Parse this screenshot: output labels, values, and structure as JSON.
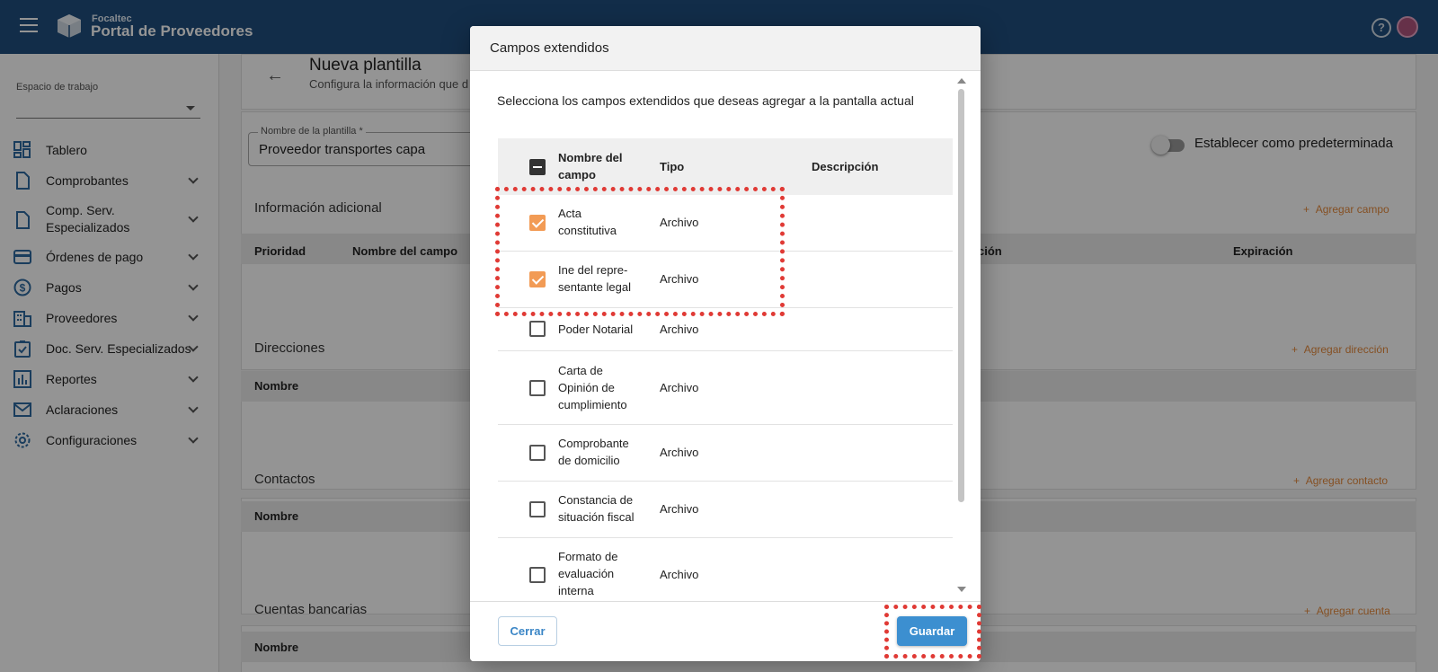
{
  "app": {
    "brand_small": "Focaltec",
    "brand_big": "Portal de Proveedores"
  },
  "sidebar": {
    "workspace_label": "Espacio de trabajo",
    "workspace_value": "",
    "items": [
      {
        "label": "Tablero",
        "icon": "dashboard-icon"
      },
      {
        "label": "Comprobantes",
        "icon": "document-icon"
      },
      {
        "label": "Comp. Serv. Especializados",
        "icon": "document-icon"
      },
      {
        "label": "Órdenes de pago",
        "icon": "credit-card-icon"
      },
      {
        "label": "Pagos",
        "icon": "dollar-icon"
      },
      {
        "label": "Proveedores",
        "icon": "building-icon"
      },
      {
        "label": "Doc. Serv. Especializados",
        "icon": "clipboard-check-icon"
      },
      {
        "label": "Reportes",
        "icon": "bar-chart-icon"
      },
      {
        "label": "Aclaraciones",
        "icon": "mail-icon"
      },
      {
        "label": "Configuraciones",
        "icon": "gear-icon"
      }
    ]
  },
  "page": {
    "title": "Nueva plantilla",
    "subtitle": "Configura la información que d",
    "template_name_label": "Nombre de la plantilla *",
    "template_name_value": "Proveedor transportes capa",
    "default_toggle_label": "Establecer como predeterminada",
    "default_toggle_on": false,
    "sections": [
      {
        "title": "Información adicional",
        "action": "Agregar campo",
        "headers": [
          "Prioridad",
          "Nombre del campo",
          "ción",
          "Expiración"
        ]
      },
      {
        "title": "Direcciones",
        "action": "Agregar dirección",
        "headers": [
          "Nombre"
        ]
      },
      {
        "title": "Contactos",
        "action": "Agregar contacto",
        "headers": [
          "Nombre"
        ]
      },
      {
        "title": "Cuentas bancarias",
        "action": "Agregar cuenta",
        "headers": [
          "Nombre"
        ]
      }
    ]
  },
  "modal": {
    "title": "Campos extendidos",
    "description": "Selecciona los campos extendidos que deseas agregar a la pantalla actual",
    "columns": {
      "name": "Nombre del campo",
      "type": "Tipo",
      "description": "Descripción"
    },
    "rows": [
      {
        "name": "Acta constitutiva",
        "type": "Archivo",
        "checked": true
      },
      {
        "name": "Ine del repre-sentante legal",
        "type": "Archivo",
        "checked": true
      },
      {
        "name": "Poder Notarial",
        "type": "Archivo",
        "checked": false
      },
      {
        "name": "Carta de Opinión de cumplimiento",
        "type": "Archivo",
        "checked": false
      },
      {
        "name": "Comprobante de domicilio",
        "type": "Archivo",
        "checked": false
      },
      {
        "name": "Constancia de situación fiscal",
        "type": "Archivo",
        "checked": false
      },
      {
        "name": "Formato de evaluación interna",
        "type": "Archivo",
        "checked": false
      }
    ],
    "close_label": "Cerrar",
    "save_label": "Guardar",
    "colors": {
      "primary": "#3c8fd0",
      "accent": "#f29b55",
      "highlight": "#e03a35"
    }
  }
}
